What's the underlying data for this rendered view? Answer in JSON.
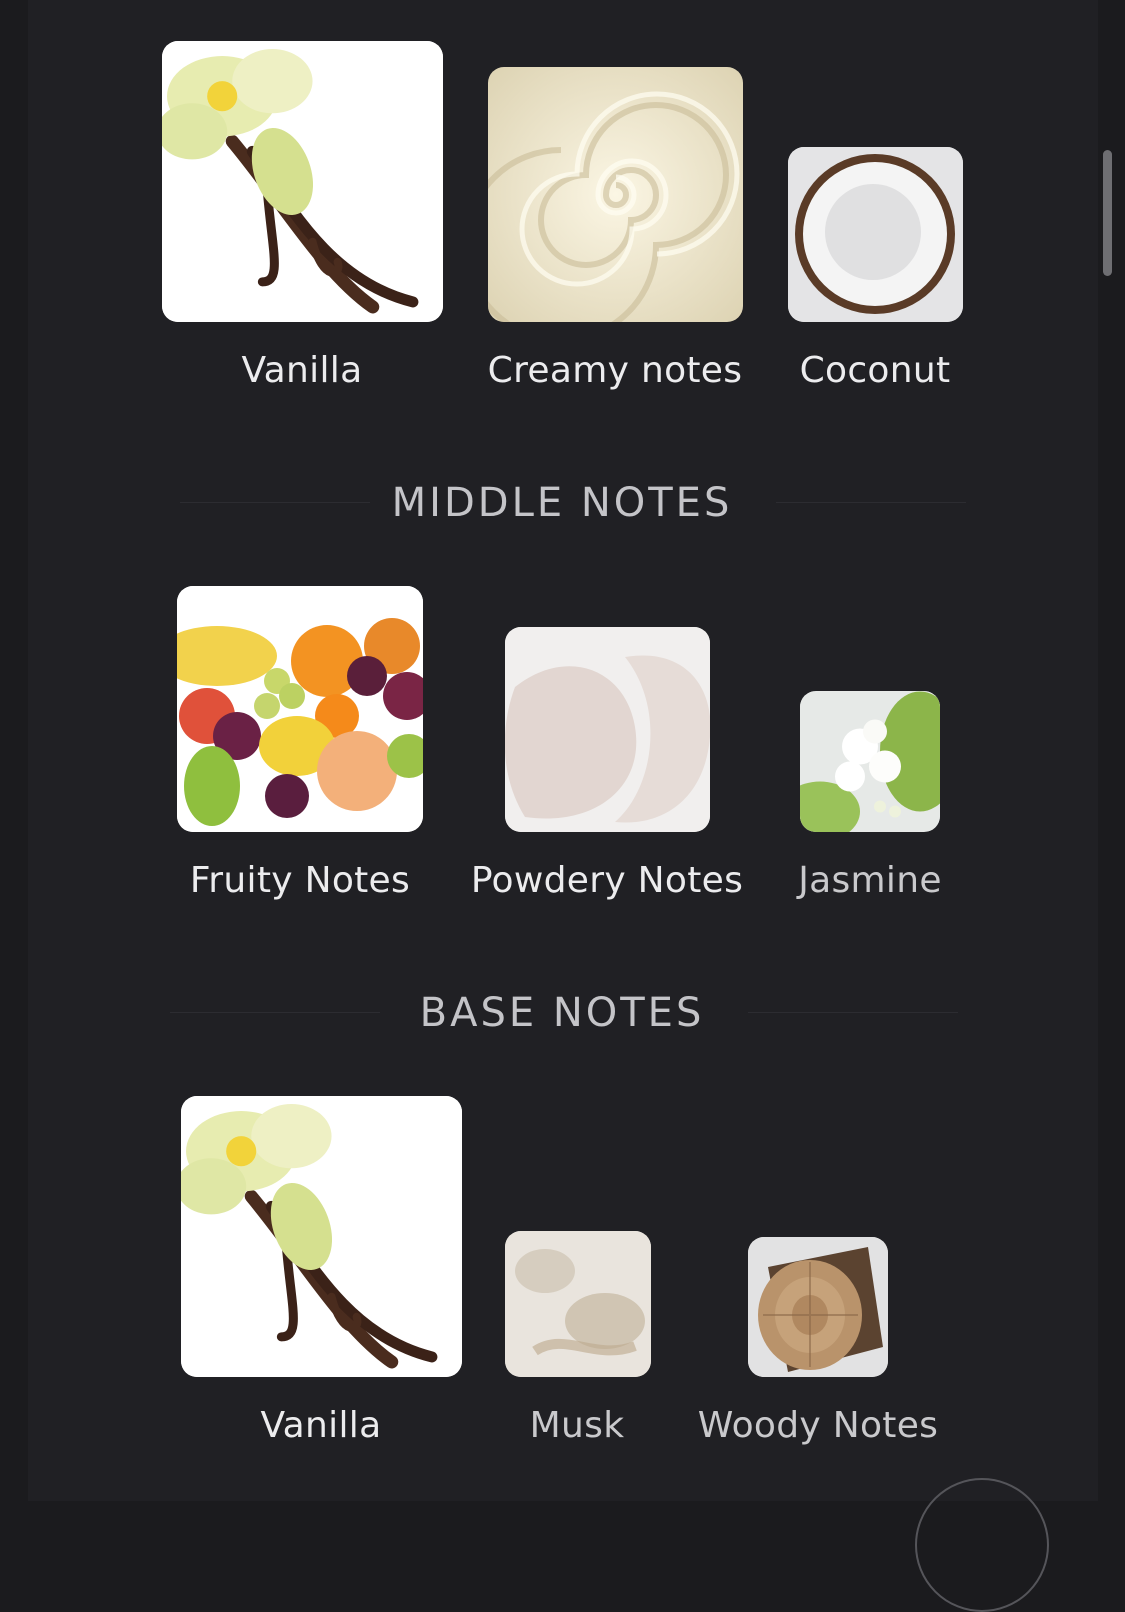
{
  "sections": {
    "top": {
      "items": [
        {
          "label": "Vanilla",
          "icon": "vanilla-image"
        },
        {
          "label": "Creamy notes",
          "icon": "cream-swirl-image"
        },
        {
          "label": "Coconut",
          "icon": "coconut-image"
        }
      ]
    },
    "middle": {
      "title": "MIDDLE NOTES",
      "items": [
        {
          "label": "Fruity Notes",
          "icon": "fruit-image"
        },
        {
          "label": "Powdery Notes",
          "icon": "powder-image"
        },
        {
          "label": "Jasmine",
          "icon": "jasmine-image"
        }
      ]
    },
    "base": {
      "title": "BASE NOTES",
      "items": [
        {
          "label": "Vanilla",
          "icon": "vanilla-image"
        },
        {
          "label": "Musk",
          "icon": "musk-image"
        },
        {
          "label": "Woody Notes",
          "icon": "wood-image"
        }
      ]
    }
  },
  "colors": {
    "background": "#202024",
    "text": "#ececee",
    "heading": "#c4c4c8"
  }
}
